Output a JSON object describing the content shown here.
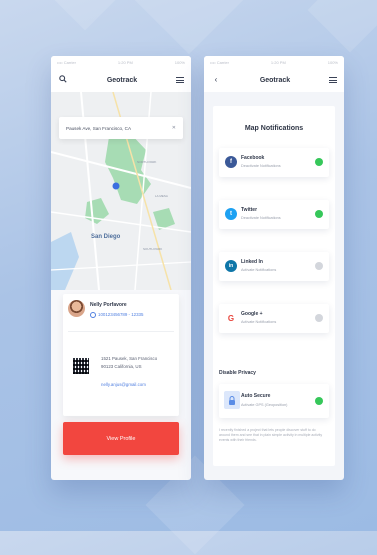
{
  "colors": {
    "accent_red": "#f2463f",
    "toggle_on": "#36c75a",
    "toggle_off": "#d3d6dc",
    "link_blue": "#4f7fe0"
  },
  "left_screen": {
    "status": {
      "left": "•••• Carrier",
      "time": "1:20 PM",
      "battery": "100%"
    },
    "header": {
      "title": "Geotrack",
      "left_icon": "search-icon",
      "right_icon": "menu-icon"
    },
    "address_bar": {
      "value": "Pausek Ave, San Francisco, CA",
      "right_icon": "close-icon"
    },
    "map": {
      "city_label": "San Diego",
      "small_labels": [
        "NORTH PARK",
        "SOUTH PARK",
        "LA MESA"
      ]
    },
    "user": {
      "name": "Nelly Porfavore",
      "id": "100123456789 - 12335",
      "address_lines": [
        "1521 Pausek, San Francisco",
        "90123 California, US"
      ],
      "email": "nelly.anjus@gmail.com"
    },
    "view_profile_label": "View Profile"
  },
  "right_screen": {
    "status": {
      "left": "•••• Carrier",
      "time": "1:20 PM",
      "battery": "100%"
    },
    "header": {
      "title": "Geotrack",
      "left_icon": "back-chevron-icon",
      "right_icon": "menu-icon"
    },
    "panel_title": "Map Notifications",
    "notifications": [
      {
        "name": "Facebook",
        "sub": "Deactivate Notifications",
        "icon": "facebook-icon",
        "glyph": "f",
        "color": "#3b5998",
        "on": true
      },
      {
        "name": "Twitter",
        "sub": "Deactivate Notifications",
        "icon": "twitter-icon",
        "glyph": "t",
        "color": "#1da1f2",
        "on": true
      },
      {
        "name": "Linked In",
        "sub": "Activate Notifications",
        "icon": "linkedin-icon",
        "glyph": "in",
        "color": "#0e76a8",
        "on": false
      },
      {
        "name": "Google +",
        "sub": "Activate Notifications",
        "icon": "google-icon",
        "glyph": "G",
        "color": "#ffffff",
        "on": false
      }
    ],
    "privacy_section": "Disable Privacy",
    "privacy_item": {
      "name": "Auto Secure",
      "sub": "Activate GPS (Geoposition)",
      "icon": "lock-icon",
      "on": true
    },
    "privacy_description": "I recently finished a project that lets people discover stuff to do around them and see that in plain simple activity in multiple activity events with their friends."
  }
}
